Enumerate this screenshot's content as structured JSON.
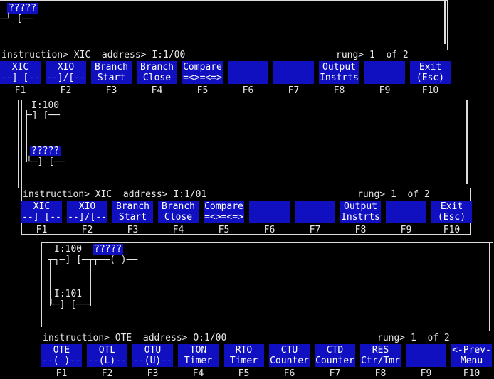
{
  "panel1": {
    "tag": "?????",
    "rung_text": "─┘ [──",
    "prompt": "instruction> XIC  address> I:1/00",
    "rung_info": "rung> 1  of 2",
    "fkeys": [
      {
        "l1": "XIC",
        "l2": "--] [--",
        "num": "F1"
      },
      {
        "l1": "XIO",
        "l2": "--]/[--",
        "num": "F2"
      },
      {
        "l1": "Branch",
        "l2": "Start",
        "num": "F3"
      },
      {
        "l1": "Branch",
        "l2": "Close",
        "num": "F4"
      },
      {
        "l1": "Compare",
        "l2": "=<>=<=>",
        "num": "F5"
      },
      {
        "l1": "",
        "l2": "",
        "num": "F6"
      },
      {
        "l1": "",
        "l2": "",
        "num": "F7"
      },
      {
        "l1": "Output",
        "l2": "Instrts",
        "num": "F8"
      },
      {
        "l1": "",
        "l2": "",
        "num": "F9"
      },
      {
        "l1": "Exit",
        "l2": "(Esc)",
        "num": "F10"
      }
    ]
  },
  "panel2": {
    "addr1": "I:100",
    "contact1": "─] [──",
    "tag": "?????",
    "contact2": "└─] [──",
    "prompt": "instruction> XIC  address> I:1/01",
    "rung_info": "rung> 1  of 2",
    "fkeys": [
      {
        "l1": "XIC",
        "l2": "--] [--",
        "num": "F1"
      },
      {
        "l1": "XIO",
        "l2": "--]/[--",
        "num": "F2"
      },
      {
        "l1": "Branch",
        "l2": "Start",
        "num": "F3"
      },
      {
        "l1": "Branch",
        "l2": "Close",
        "num": "F4"
      },
      {
        "l1": "Compare",
        "l2": "=<>=<=>",
        "num": "F5"
      },
      {
        "l1": "",
        "l2": "",
        "num": "F6"
      },
      {
        "l1": "",
        "l2": "",
        "num": "F7"
      },
      {
        "l1": "Output",
        "l2": "Instrts",
        "num": "F8"
      },
      {
        "l1": "",
        "l2": "",
        "num": "F9"
      },
      {
        "l1": "Exit",
        "l2": "(Esc)",
        "num": "F10"
      }
    ]
  },
  "panel3": {
    "addr1": "I:100",
    "tag": "?????",
    "rung_line": "─┐─] [──┬──( )──",
    "addr2": "I:101",
    "contact2": "└─] [──┘",
    "prompt": "instruction> OTE  address> O:1/00",
    "rung_info": "rung> 1  of 2",
    "fkeys": [
      {
        "l1": "OTE",
        "l2": "--( )--",
        "num": "F1"
      },
      {
        "l1": "OTL",
        "l2": "--(L)--",
        "num": "F2"
      },
      {
        "l1": "OTU",
        "l2": "--(U)--",
        "num": "F3"
      },
      {
        "l1": "TON",
        "l2": "Timer",
        "num": "F4"
      },
      {
        "l1": "RTO",
        "l2": "Timer",
        "num": "F5"
      },
      {
        "l1": "CTU",
        "l2": "Counter",
        "num": "F6"
      },
      {
        "l1": "CTD",
        "l2": "Counter",
        "num": "F7"
      },
      {
        "l1": "RES",
        "l2": "Ctr/Tmr",
        "num": "F8"
      },
      {
        "l1": "",
        "l2": "",
        "num": "F9"
      },
      {
        "l1": "<-Prev-",
        "l2": "Menu",
        "num": "F10"
      }
    ]
  }
}
